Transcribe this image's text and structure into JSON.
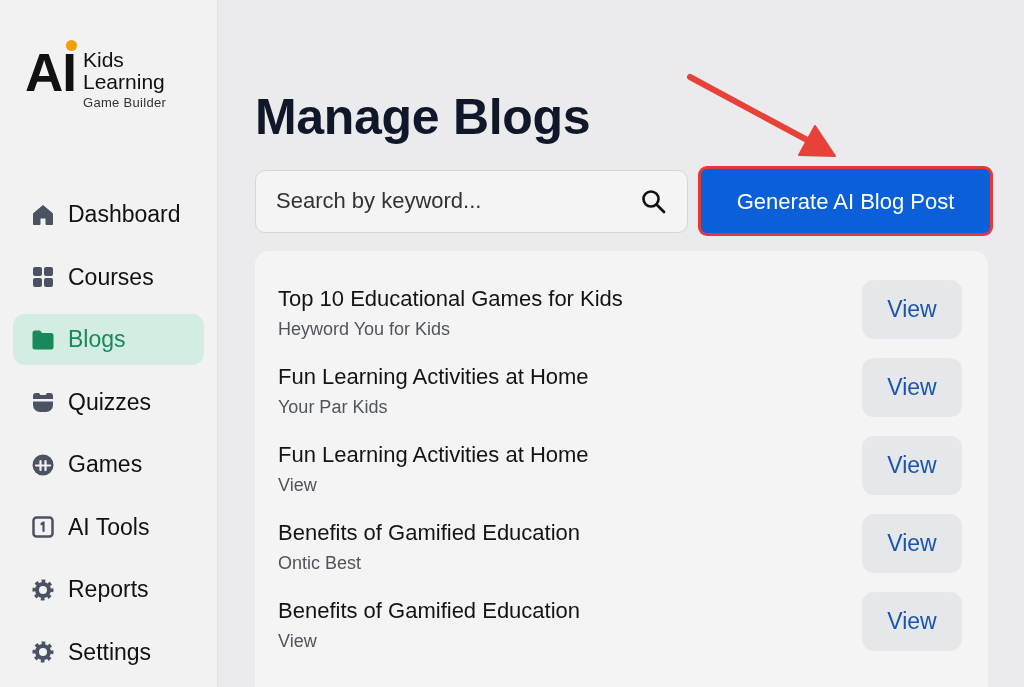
{
  "logo": {
    "mark": "AI",
    "name_lines": [
      "Kids",
      "Learning"
    ],
    "tagline": "Game Builder"
  },
  "sidebar": {
    "items": [
      {
        "label": "Dashboard",
        "selected": false
      },
      {
        "label": "Courses",
        "selected": false
      },
      {
        "label": "Blogs",
        "selected": true
      },
      {
        "label": "Quizzes",
        "selected": false
      },
      {
        "label": "Games",
        "selected": false
      },
      {
        "label": "AI Tools",
        "selected": false
      },
      {
        "label": "Reports",
        "selected": false
      },
      {
        "label": "Settings",
        "selected": false
      }
    ]
  },
  "page_title": "Manage Blogs",
  "search": {
    "placeholder": "Search by keyword..."
  },
  "generate_button": {
    "label": "Generate AI Blog Post",
    "highlighted": true
  },
  "blog_list": {
    "rows": [
      {
        "title": "Top 10 Educational Games for Kids",
        "subtitle": "Heyword You for Kids",
        "action": "View"
      },
      {
        "title": "Fun Learning Activities at Home",
        "subtitle": "Your Par Kids",
        "action": "View"
      },
      {
        "title": "Fun Learning Activities at Home",
        "subtitle": "View",
        "action": "View"
      },
      {
        "title": "Benefits of Gamified Education",
        "subtitle": "Ontic Best",
        "action": "View"
      },
      {
        "title": "Benefits of Gamified Education",
        "subtitle": "View",
        "action": "View"
      }
    ]
  }
}
